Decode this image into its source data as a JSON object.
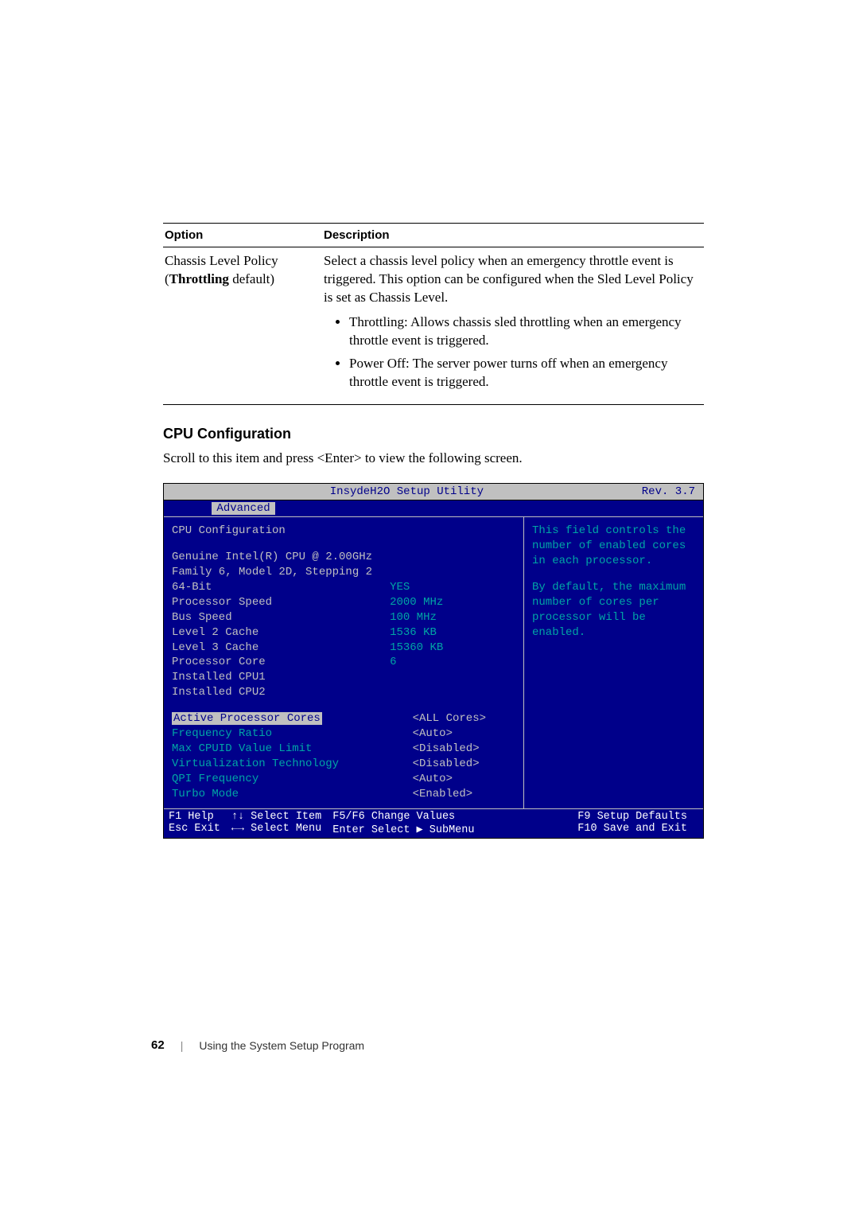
{
  "table": {
    "header_option": "Option",
    "header_desc": "Description",
    "opt_line1": "Chassis Level Policy",
    "opt_line2a": "(",
    "opt_line2b": "Throttling",
    "opt_line2c": " default)",
    "desc_para": "Select a chassis level policy when an emergency throttle event is triggered. This option can be configured when the Sled Level Policy is set as Chassis Level.",
    "bullet1": "Throttling: Allows chassis sled throttling when an emergency throttle event is triggered.",
    "bullet2": "Power Off: The server power turns off when an emergency throttle event is triggered."
  },
  "section_heading": "CPU Configuration",
  "section_text": "Scroll to this item and press <Enter> to view the following screen.",
  "bios": {
    "title": "InsydeH2O Setup Utility",
    "rev": "Rev. 3.7",
    "tab": "Advanced",
    "cpu_conf": "CPU Configuration",
    "cpu_name": "Genuine Intel(R) CPU  @ 2.00GHz",
    "cpu_fam": "Family 6, Model 2D, Stepping 2",
    "rows_info": [
      {
        "k": "64-Bit",
        "v": "YES"
      },
      {
        "k": "Processor Speed",
        "v": "2000 MHz"
      },
      {
        "k": "Bus Speed",
        "v": "100 MHz"
      },
      {
        "k": "Level 2 Cache",
        "v": "1536 KB"
      },
      {
        "k": "Level 3 Cache",
        "v": "15360 KB"
      },
      {
        "k": "Processor Core",
        "v": "6"
      },
      {
        "k": "Installed CPU1",
        "v": ""
      },
      {
        "k": "Installed CPU2",
        "v": ""
      }
    ],
    "rows_conf": [
      {
        "k": "Active Processor Cores",
        "v": "<ALL Cores>",
        "sel": true
      },
      {
        "k": "Frequency Ratio",
        "v": "<Auto>"
      },
      {
        "k": "Max CPUID Value Limit",
        "v": "<Disabled>"
      },
      {
        "k": "Virtualization Technology",
        "v": "<Disabled>"
      },
      {
        "k": "QPI Frequency",
        "v": "<Auto>"
      },
      {
        "k": "Turbo Mode",
        "v": "<Enabled>"
      }
    ],
    "help": "This field controls the number of enabled cores in each processor.",
    "help2": "By default, the maximum number of cores per processor will be enabled.",
    "foot": {
      "f1": "F1  Help",
      "esc": "Esc Exit",
      "ud": "↑↓ Select Item",
      "lr": "←→ Select Menu",
      "f56": "F5/F6 Change Values",
      "enter": "Enter Select ▶ SubMenu",
      "f9": "F9  Setup Defaults",
      "f10": "F10 Save and Exit"
    }
  },
  "footer": {
    "page_num": "62",
    "text": "Using the System Setup Program"
  }
}
